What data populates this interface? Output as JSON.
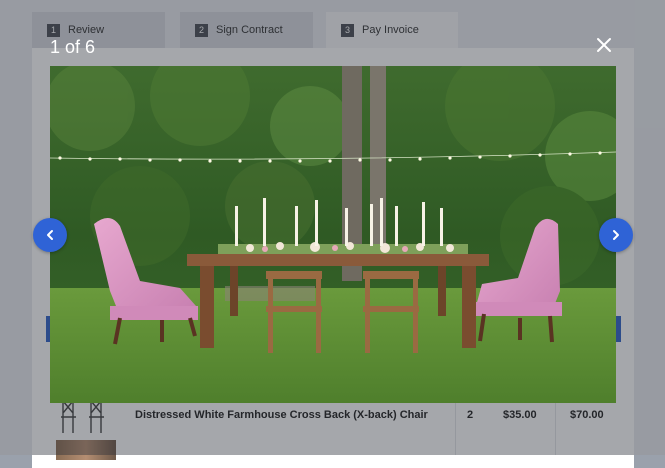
{
  "steps": [
    {
      "num": "1",
      "label": "Review"
    },
    {
      "num": "2",
      "label": "Sign Contract"
    },
    {
      "num": "3",
      "label": "Pay Invoice"
    }
  ],
  "line_item": {
    "name": "Distressed White Farmhouse Cross Back (X-back) Chair",
    "qty": "2",
    "price": "$35.00",
    "total": "$70.00"
  },
  "lightbox": {
    "counter": "1 of 6",
    "close_icon": "close-icon",
    "prev_icon": "chevron-left-icon",
    "next_icon": "chevron-right-icon",
    "accent_color": "#2f63d6"
  }
}
